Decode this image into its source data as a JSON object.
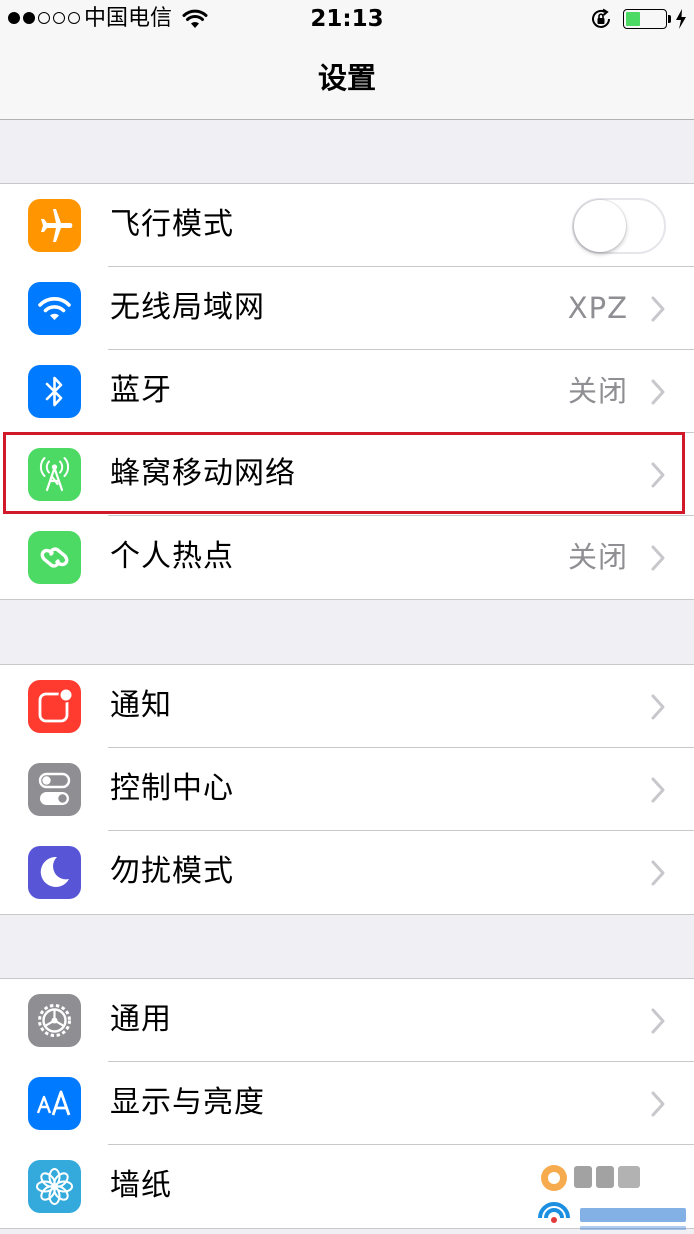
{
  "status_bar": {
    "carrier": "中国电信",
    "time": "21:13",
    "signal_bars_filled": 2,
    "signal_bars_total": 5,
    "battery_level": 0.4,
    "icons": [
      "wifi-icon",
      "rotation-lock-icon",
      "battery-icon",
      "charging-bolt-icon"
    ]
  },
  "nav": {
    "title": "设置"
  },
  "groups": [
    {
      "rows": [
        {
          "id": "airplane",
          "label": "飞行模式",
          "value": "",
          "icon": "airplane-icon",
          "icon_color": "#ff9500",
          "toggle": true,
          "toggle_on": false
        },
        {
          "id": "wifi",
          "label": "无线局域网",
          "value": "XPZ",
          "icon": "wifi-icon",
          "icon_color": "#007aff"
        },
        {
          "id": "bluetooth",
          "label": "蓝牙",
          "value": "关闭",
          "icon": "bluetooth-icon",
          "icon_color": "#007aff"
        },
        {
          "id": "cellular",
          "label": "蜂窝移动网络",
          "value": "",
          "icon": "cellular-antenna-icon",
          "icon_color": "#4cd964",
          "highlighted": true
        },
        {
          "id": "hotspot",
          "label": "个人热点",
          "value": "关闭",
          "icon": "hotspot-link-icon",
          "icon_color": "#4cd964"
        }
      ]
    },
    {
      "rows": [
        {
          "id": "notifications",
          "label": "通知",
          "value": "",
          "icon": "notifications-icon",
          "icon_color": "#ff3b30"
        },
        {
          "id": "control-center",
          "label": "控制中心",
          "value": "",
          "icon": "control-center-icon",
          "icon_color": "#8e8e93"
        },
        {
          "id": "do-not-disturb",
          "label": "勿扰模式",
          "value": "",
          "icon": "moon-icon",
          "icon_color": "#5856d6"
        }
      ]
    },
    {
      "rows": [
        {
          "id": "general",
          "label": "通用",
          "value": "",
          "icon": "gear-icon",
          "icon_color": "#8e8e93"
        },
        {
          "id": "display",
          "label": "显示与亮度",
          "value": "",
          "icon": "text-size-icon",
          "icon_color": "#007aff"
        },
        {
          "id": "wallpaper",
          "label": "墙纸",
          "value": "",
          "icon": "flower-icon",
          "icon_color": "#34aadc"
        }
      ]
    }
  ],
  "watermark": {
    "icon": "watermark-logo"
  }
}
